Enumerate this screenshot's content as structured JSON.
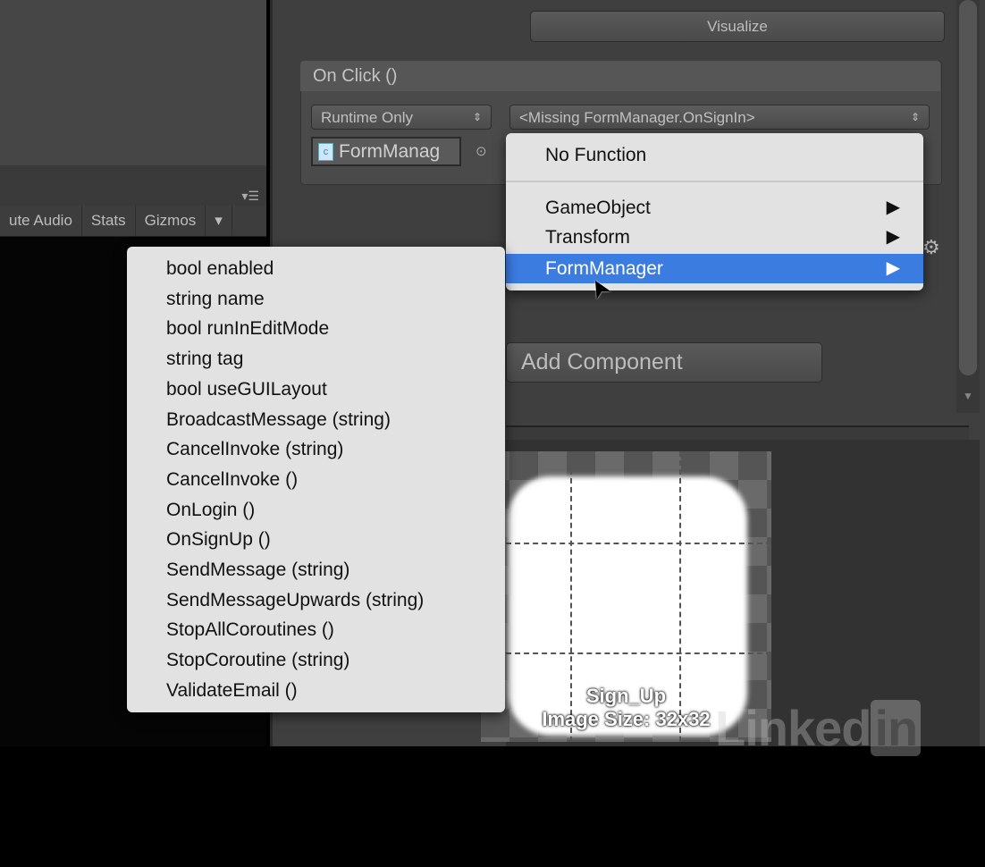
{
  "toolbar": {
    "items": [
      "ute Audio",
      "Stats",
      "Gizmos"
    ]
  },
  "inspector": {
    "visualize_label": "Visualize",
    "on_click": {
      "title": "On Click ()",
      "runtime": "Runtime Only",
      "function": "<Missing FormManager.OnSignIn>",
      "object": "FormManag"
    },
    "add_component": "Add Component"
  },
  "function_menu": {
    "items": [
      {
        "label": "No Function"
      },
      {
        "label": "GameObject",
        "submenu": true
      },
      {
        "label": "Transform",
        "submenu": true
      },
      {
        "label": "FormManager",
        "submenu": true,
        "highlighted": true
      }
    ]
  },
  "formmanager_submenu": {
    "items": [
      "bool enabled",
      "string name",
      "bool runInEditMode",
      "string tag",
      "bool useGUILayout",
      "BroadcastMessage (string)",
      "CancelInvoke (string)",
      "CancelInvoke ()",
      "OnLogin ()",
      "OnSignUp ()",
      "SendMessage (string)",
      "SendMessageUpwards (string)",
      "StopAllCoroutines ()",
      "StopCoroutine (string)",
      "ValidateEmail ()"
    ]
  },
  "preview": {
    "name": "Sign_Up",
    "size": "Image Size: 32x32"
  },
  "watermark": {
    "text": "Linked",
    "badge": "in"
  },
  "colors": {
    "highlight": "#3b7ce1",
    "menu_bg": "#e2e2e2",
    "panel": "#3f3f3f"
  }
}
